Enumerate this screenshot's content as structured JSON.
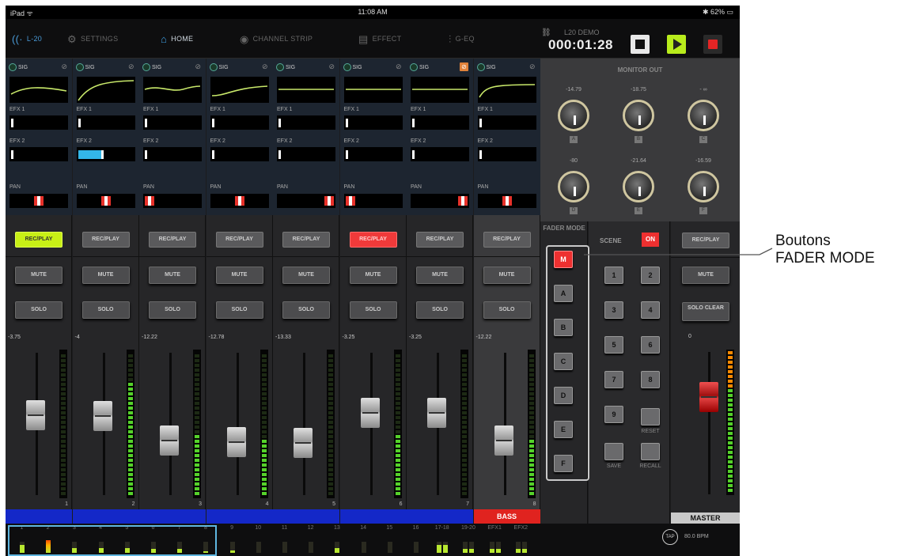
{
  "status": {
    "left": "iPad ᯤ",
    "time": "11:08 AM",
    "battery": "✱ 62% ▭"
  },
  "nav": {
    "items": [
      {
        "label": "L-20",
        "icon": "wave-icon"
      },
      {
        "label": "SETTINGS",
        "icon": "gear-icon"
      },
      {
        "label": "HOME",
        "icon": "home-icon"
      },
      {
        "label": "CHANNEL STRIP",
        "icon": "knob-icon"
      },
      {
        "label": "EFFECT",
        "icon": "effect-icon"
      },
      {
        "label": "G-EQ",
        "icon": "sliders-icon"
      }
    ],
    "active": "HOME"
  },
  "transport": {
    "project": "L20 DEMO",
    "time": "000:01:28",
    "link_icon": "link-icon"
  },
  "labels": {
    "sig": "SIG",
    "efx1": "EFX 1",
    "efx2": "EFX 2",
    "pan": "PAN",
    "recplay": "REC/PLAY",
    "mute": "MUTE",
    "solo": "SOLO",
    "solo_clear": "SOLO CLEAR",
    "master": "MASTER"
  },
  "channels": [
    {
      "fader_value": "-3.75",
      "number": "1",
      "name": "",
      "rec_state": "green",
      "eq": "flat",
      "efx2": 0,
      "pan": 0.5,
      "fader": 0.58,
      "meter": 0,
      "phase_on": false
    },
    {
      "fader_value": "-4",
      "number": "2",
      "name": "",
      "rec_state": "normal",
      "eq": "rise",
      "efx2": 0.45,
      "pan": 0.5,
      "fader": 0.57,
      "meter": 1.0,
      "phase_on": false
    },
    {
      "fader_value": "-12.22",
      "number": "3",
      "name": "",
      "rec_state": "normal",
      "eq": "dip",
      "efx2": 0,
      "pan": 0.0,
      "fader": 0.35,
      "meter": 0.55,
      "phase_on": false
    },
    {
      "fader_value": "-12.78",
      "number": "4",
      "name": "",
      "rec_state": "normal",
      "eq": "curve",
      "efx2": 0,
      "pan": 0.5,
      "fader": 0.34,
      "meter": 0.5,
      "phase_on": false
    },
    {
      "fader_value": "-13.33",
      "number": "5",
      "name": "",
      "rec_state": "normal",
      "eq": "flat2",
      "efx2": 0,
      "pan": 1.0,
      "fader": 0.33,
      "meter": 0,
      "phase_on": false
    },
    {
      "fader_value": "-3.25",
      "number": "6",
      "name": "",
      "rec_state": "red",
      "eq": "flat2",
      "efx2": 0,
      "pan": 0.0,
      "fader": 0.6,
      "meter": 0.55,
      "phase_on": false
    },
    {
      "fader_value": "-3.25",
      "number": "7",
      "name": "",
      "rec_state": "normal",
      "eq": "flat2",
      "efx2": 0,
      "pan": 1.0,
      "fader": 0.6,
      "meter": 0,
      "phase_on": true
    },
    {
      "fader_value": "-12.22",
      "number": "8",
      "name": "BASS",
      "rec_state": "normal",
      "eq": "hp",
      "efx2": 0,
      "pan": 0.5,
      "fader": 0.35,
      "meter": 0.5,
      "phase_on": false
    }
  ],
  "monitor": {
    "title": "MONITOR OUT",
    "knobs": [
      {
        "value": "-14.79",
        "label": "A"
      },
      {
        "value": "-18.75",
        "label": "B"
      },
      {
        "value": "- ∞",
        "label": "C"
      },
      {
        "value": "-80",
        "label": "D"
      },
      {
        "value": "-21.64",
        "label": "E"
      },
      {
        "value": "-16.59",
        "label": "F"
      }
    ]
  },
  "fader_mode": {
    "title": "FADER MODE",
    "buttons": [
      "M",
      "A",
      "B",
      "C",
      "D",
      "E",
      "F"
    ],
    "selected": "M"
  },
  "scene": {
    "title": "SCENE",
    "on_label": "ON",
    "numbers": [
      "1",
      "2",
      "3",
      "4",
      "5",
      "6",
      "7",
      "8",
      "9"
    ],
    "reset": "RESET",
    "save": "SAVE",
    "recall": "RECALL"
  },
  "master": {
    "fader_value": "0",
    "label": "MASTER",
    "fader": 0.75,
    "meter": 1.0
  },
  "bottom": {
    "meters": [
      "1",
      "2",
      "3",
      "4",
      "5",
      "6",
      "7",
      "8",
      "9",
      "10",
      "11",
      "12",
      "13",
      "14",
      "15",
      "16",
      "17-18",
      "19-20",
      "EFX1",
      "EFX2"
    ],
    "levels": [
      0.6,
      1.0,
      0.35,
      0.35,
      0.35,
      0.3,
      0.3,
      0.15,
      0.2,
      0,
      0,
      0,
      0.4,
      0,
      0,
      0,
      0.6,
      0.3,
      0.3,
      0.3
    ],
    "tap": "TAP",
    "bpm": "80.0 BPM"
  },
  "annotation": {
    "line1": "Boutons",
    "line2": "FADER MODE"
  }
}
